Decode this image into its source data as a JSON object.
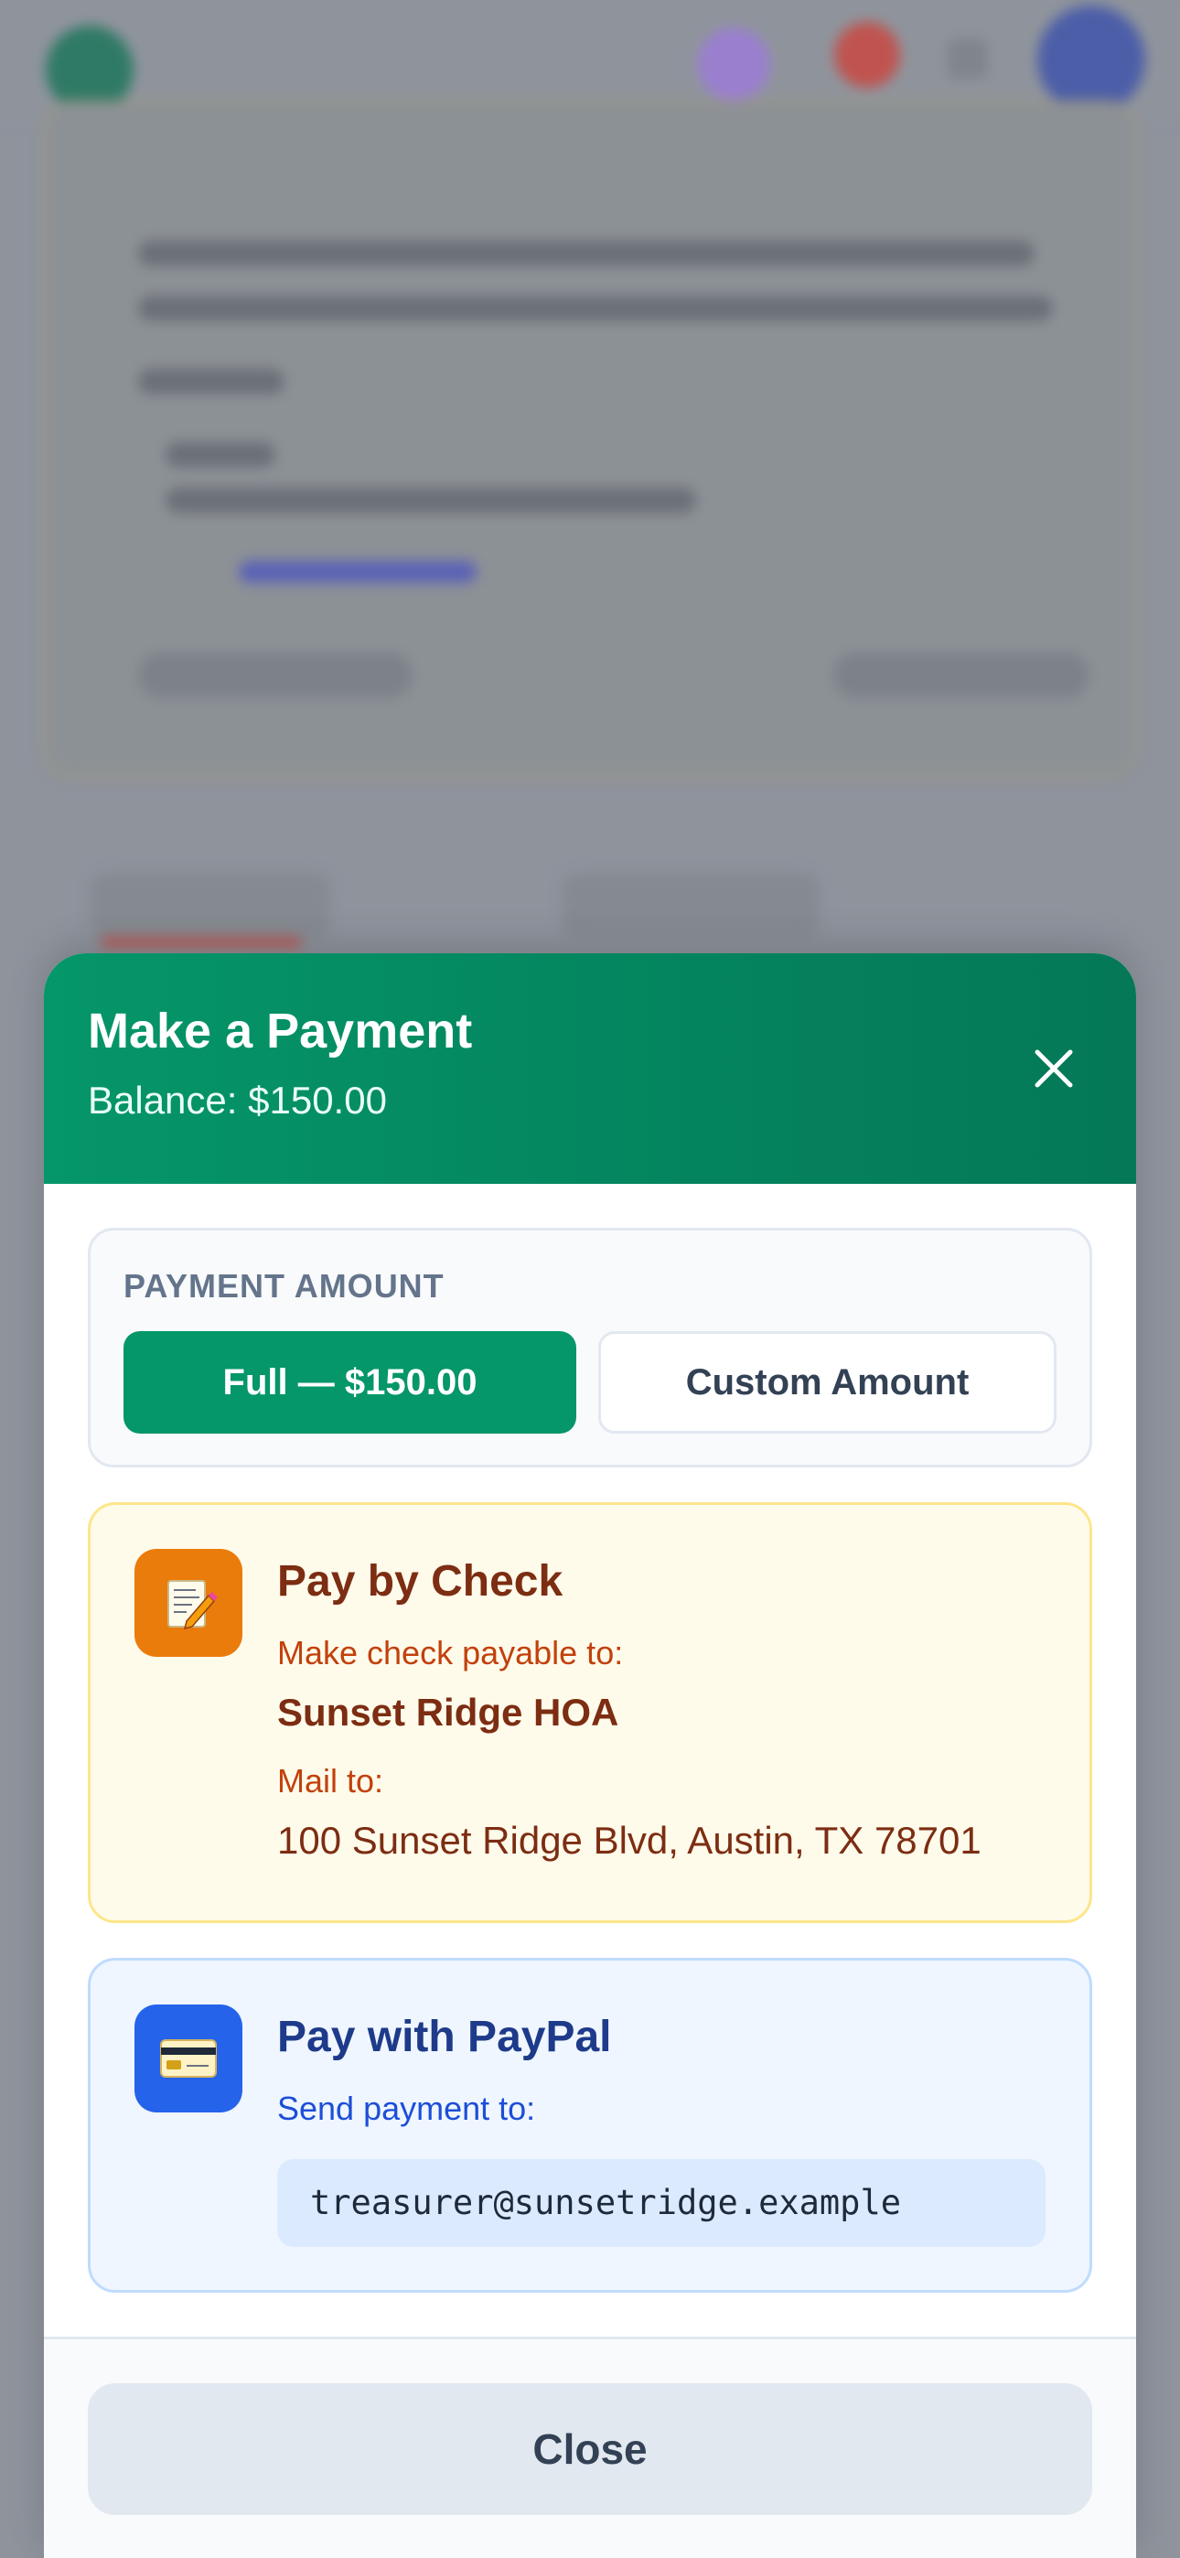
{
  "modal": {
    "title": "Make a Payment",
    "balance": "Balance: $150.00",
    "close_icon": "close-icon"
  },
  "amount": {
    "label": "PAYMENT AMOUNT",
    "full_label": "Full — $150.00",
    "custom_label": "Custom Amount"
  },
  "check": {
    "icon": "memo-icon",
    "title": "Pay by Check",
    "payable_label": "Make check payable to:",
    "payable_to": "Sunset Ridge HOA",
    "mail_label": "Mail to:",
    "mail_address": "100 Sunset Ridge Blvd, Austin, TX 78701"
  },
  "paypal": {
    "icon": "credit-card-icon",
    "title": "Pay with PayPal",
    "send_label": "Send payment to:",
    "email": "treasurer@sunsetridge.example"
  },
  "footer": {
    "close_label": "Close"
  },
  "colors": {
    "header_start": "#059669",
    "header_end": "#047857",
    "check_bg": "#fffbeb",
    "check_icon": "#ea7c0c",
    "paypal_bg": "#eff6ff",
    "paypal_icon": "#2563eb"
  }
}
